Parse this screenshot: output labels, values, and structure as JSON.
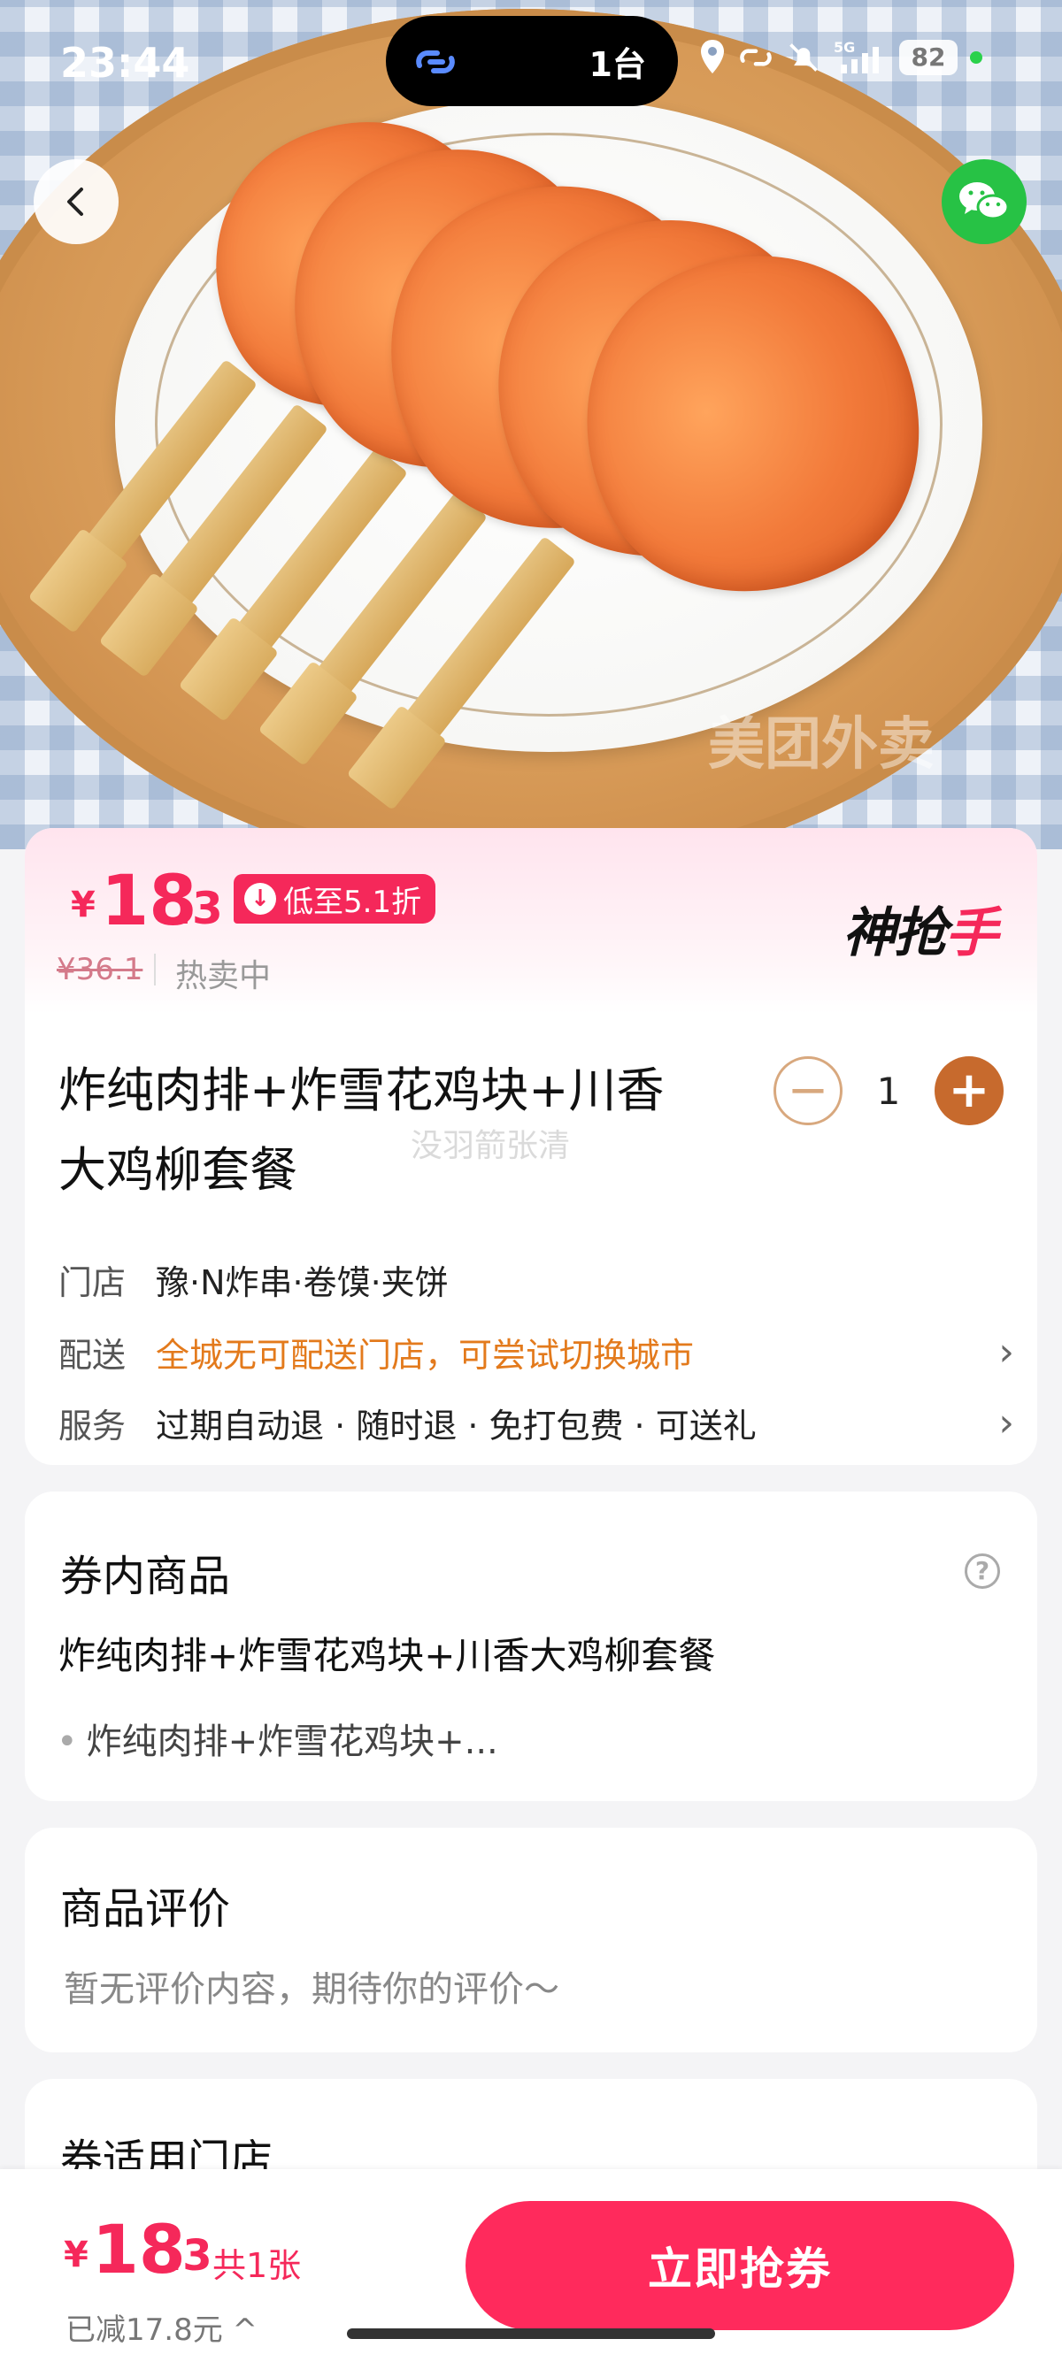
{
  "status_bar": {
    "time": "23:44",
    "island_text": "1台",
    "network": "5G",
    "battery": "82"
  },
  "hero": {
    "watermark": "美团外卖"
  },
  "price": {
    "currency": "¥",
    "integer": "18",
    "decimal": ".3",
    "discount_tag": "低至5.1折",
    "original": "¥36.1",
    "status": "热卖中",
    "brand_main": "神抢",
    "brand_accent": "手"
  },
  "product": {
    "title_line1": "炸纯肉排+炸雪花鸡块+川香",
    "title_line2": "大鸡柳套餐",
    "title_watermark": "没羽箭张清",
    "quantity": "1",
    "minus_symbol": "−",
    "plus_symbol": "+"
  },
  "details": {
    "store_label": "门店",
    "store_value": "豫·N炸串·卷馍·夹饼",
    "delivery_label": "配送",
    "delivery_value": "全城无可配送门店，可尝试切换城市",
    "service_label": "服务",
    "service_value": "过期自动退 · 随时退 · 免打包费 · 可送礼"
  },
  "coupon_items": {
    "heading": "券内商品",
    "item_title": "炸纯肉排+炸雪花鸡块+川香大鸡柳套餐",
    "item_bullet": "炸纯肉排+炸雪花鸡块+..."
  },
  "reviews": {
    "heading": "商品评价",
    "empty_text": "暂无评价内容，期待你的评价～"
  },
  "stores": {
    "heading": "券适用门店"
  },
  "bottom_bar": {
    "currency": "¥",
    "integer": "18",
    "decimal": ".3",
    "count": "共1张",
    "saved": "已减17.8元 ^",
    "buy_label": "立即抢券"
  },
  "colors": {
    "accent": "#f5285a",
    "orange": "#e37a1c",
    "stepper_brown": "#c76a2d",
    "wechat_green": "#27c245"
  }
}
